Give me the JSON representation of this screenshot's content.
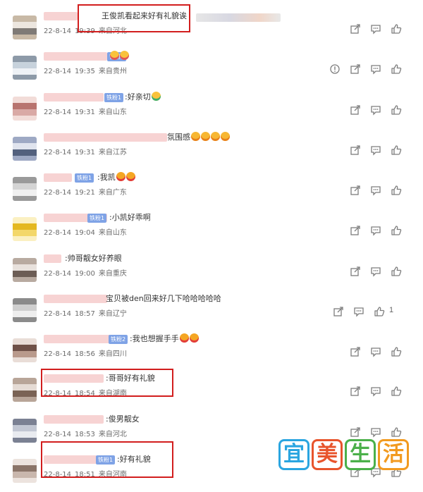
{
  "comments": [
    {
      "text": "王俊凯看起来好有礼貌诶",
      "date": "22-8-14",
      "time": "19:39",
      "location": "来自河北",
      "badge": "",
      "emojis": [],
      "report": false,
      "likes": ""
    },
    {
      "text": "",
      "date": "22-8-14",
      "time": "19:35",
      "location": "来自贵州",
      "badge": "铁粉1",
      "emojis": [
        "blush",
        "blush"
      ],
      "report": true,
      "likes": ""
    },
    {
      "text": ":好亲切",
      "date": "22-8-14",
      "time": "19:31",
      "location": "来自山东",
      "badge": "铁粉1",
      "emojis": [
        "green"
      ],
      "report": false,
      "likes": ""
    },
    {
      "text": "氛围感",
      "date": "22-8-14",
      "time": "19:31",
      "location": "来自江苏",
      "badge": "",
      "emojis": [
        "plain",
        "plain",
        "plain",
        "plain"
      ],
      "report": false,
      "likes": ""
    },
    {
      "text": ":我凯",
      "date": "22-8-14",
      "time": "19:21",
      "location": "来自广东",
      "badge": "铁粉1",
      "emojis": [
        "heart",
        "heart"
      ],
      "report": false,
      "likes": ""
    },
    {
      "text": ":小凯好乖啊",
      "date": "22-8-14",
      "time": "19:04",
      "location": "来自山东",
      "badge": "铁粉1",
      "emojis": [],
      "report": false,
      "likes": ""
    },
    {
      "text": ":帅哥靓女好养眼",
      "date": "22-8-14",
      "time": "19:00",
      "location": "来自重庆",
      "badge": "",
      "emojis": [],
      "report": false,
      "likes": ""
    },
    {
      "text": "宝贝被den回来好几下哈哈哈哈哈",
      "date": "22-8-14",
      "time": "18:57",
      "location": "来自辽宁",
      "badge": "",
      "emojis": [],
      "report": false,
      "likes": "1"
    },
    {
      "text": ":我也想握手手",
      "date": "22-8-14",
      "time": "18:56",
      "location": "来自四川",
      "badge": "铁粉2",
      "emojis": [
        "heart",
        "heart"
      ],
      "report": false,
      "likes": ""
    },
    {
      "text": ":哥哥好有礼貌",
      "date": "22-8-14",
      "time": "18:54",
      "location": "来自湖南",
      "badge": "",
      "emojis": [],
      "report": false,
      "likes": ""
    },
    {
      "text": ":俊男靓女",
      "date": "22-8-14",
      "time": "18:53",
      "location": "来自河北",
      "badge": "",
      "emojis": [],
      "report": false,
      "likes": ""
    },
    {
      "text": ":好有礼貌",
      "date": "22-8-14",
      "time": "18:51",
      "location": "来自河南",
      "badge": "铁粉1",
      "emojis": [],
      "report": false,
      "likes": ""
    }
  ],
  "watermark": {
    "chars": [
      "宜",
      "美",
      "生",
      "活"
    ],
    "colors": [
      "#2aa5e0",
      "#e8542c",
      "#4bb04a",
      "#f29a1f"
    ]
  },
  "highlight_color": "#d21e1e"
}
